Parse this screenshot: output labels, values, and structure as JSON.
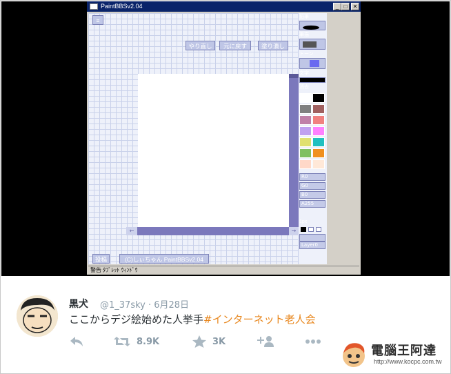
{
  "window": {
    "title": "PaintBBSv2.04",
    "min_label": "_",
    "max_label": "□",
    "close_label": "✕"
  },
  "toolbar": {
    "top_left": "≡",
    "redo": "やり直し",
    "undo": "元に戻す",
    "fill": "塗り潰し"
  },
  "scroll": {
    "left_arrow": "←",
    "right_arrow": "→"
  },
  "palette": {
    "label_pen": "鉛筆",
    "label_brush": "筆描",
    "label_tone": "トーン",
    "label_text": "文字",
    "label_eraser": "消去",
    "colors": [
      "#ffffff",
      "#000000",
      "#808080",
      "#a06060",
      "#c080a8",
      "#f08080",
      "#c0a0f0",
      "#ff80ff",
      "#e0e070",
      "#20c0c0",
      "#80c060",
      "#f09020",
      "#ffd8c8",
      "#ffe8d8"
    ],
    "r": "R0",
    "g": "G0",
    "b": "B0",
    "a": "A255",
    "px": "1px",
    "layer": "Layer0"
  },
  "bottom": {
    "post": "投稿",
    "credit": "(C)しぃちゃん PaintBBSv2.04"
  },
  "status": "警告  ﾀﾌﾞﾚｯﾄ ｳｨﾝﾄﾞｳ",
  "tweet": {
    "name": "黒犬",
    "handle": "@1_37sky · 6月28日",
    "text": "ここからデジ絵始めた人挙手",
    "hashtag": "#インターネット老人会",
    "retweets": "8.9K",
    "likes": "3K"
  },
  "watermark": {
    "brand": "電腦王阿達",
    "url": "http://www.kocpc.com.tw"
  }
}
